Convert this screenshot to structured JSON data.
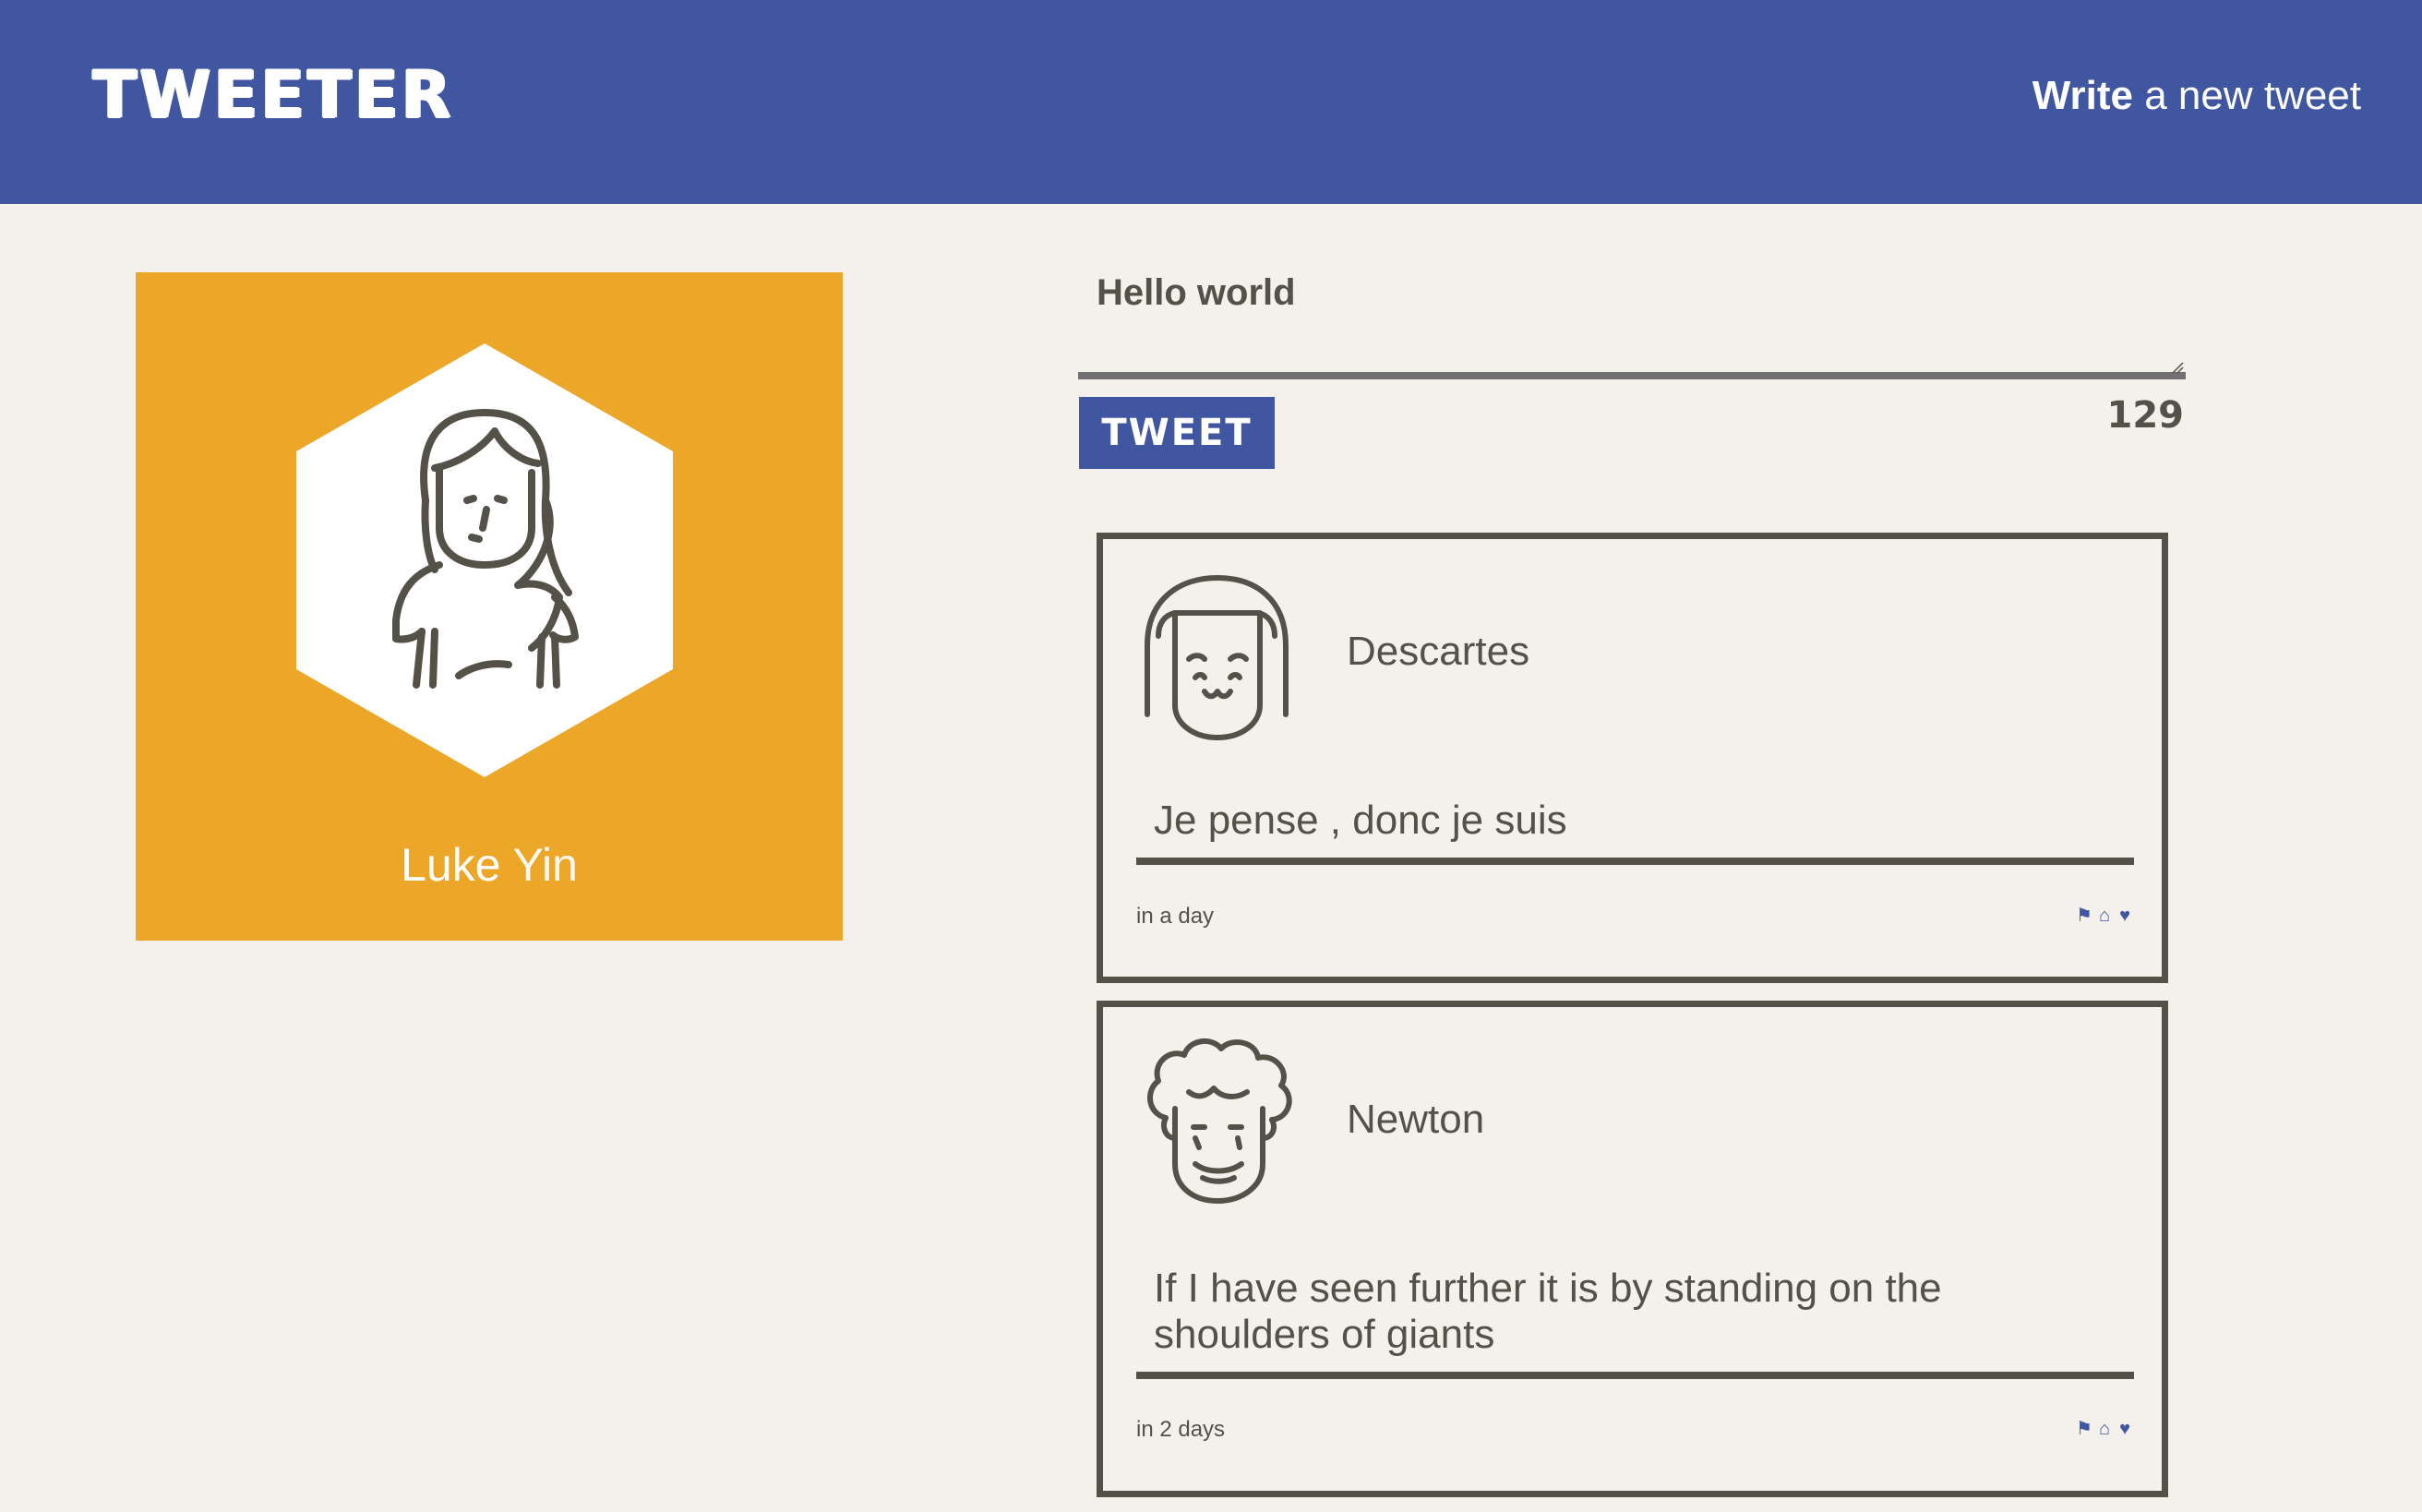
{
  "header": {
    "brand": "TWEETER",
    "compose_bold": "Write",
    "compose_rest": " a new tweet"
  },
  "profile": {
    "first_name": "Luke",
    "last_name": "Yin"
  },
  "composer": {
    "text": "Hello world",
    "button_label": "TWEET",
    "chars_remaining": "129"
  },
  "tweets": [
    {
      "author": "Descartes",
      "content": "Je pense , donc je suis",
      "time": "in a day",
      "avatar": "bob-hair-smiling-face-icon"
    },
    {
      "author": "Newton",
      "content": "If I have seen further it is by standing on the shoulders of giants",
      "time": "in 2 days",
      "avatar": "curly-hair-face-icon"
    }
  ],
  "action_icons": [
    "flag-icon",
    "retweet-icon",
    "heart-icon"
  ],
  "colors": {
    "accent": "#4056a1",
    "profile_bg": "#eca729",
    "page_bg": "#f4f1ec",
    "text": "#545149"
  }
}
